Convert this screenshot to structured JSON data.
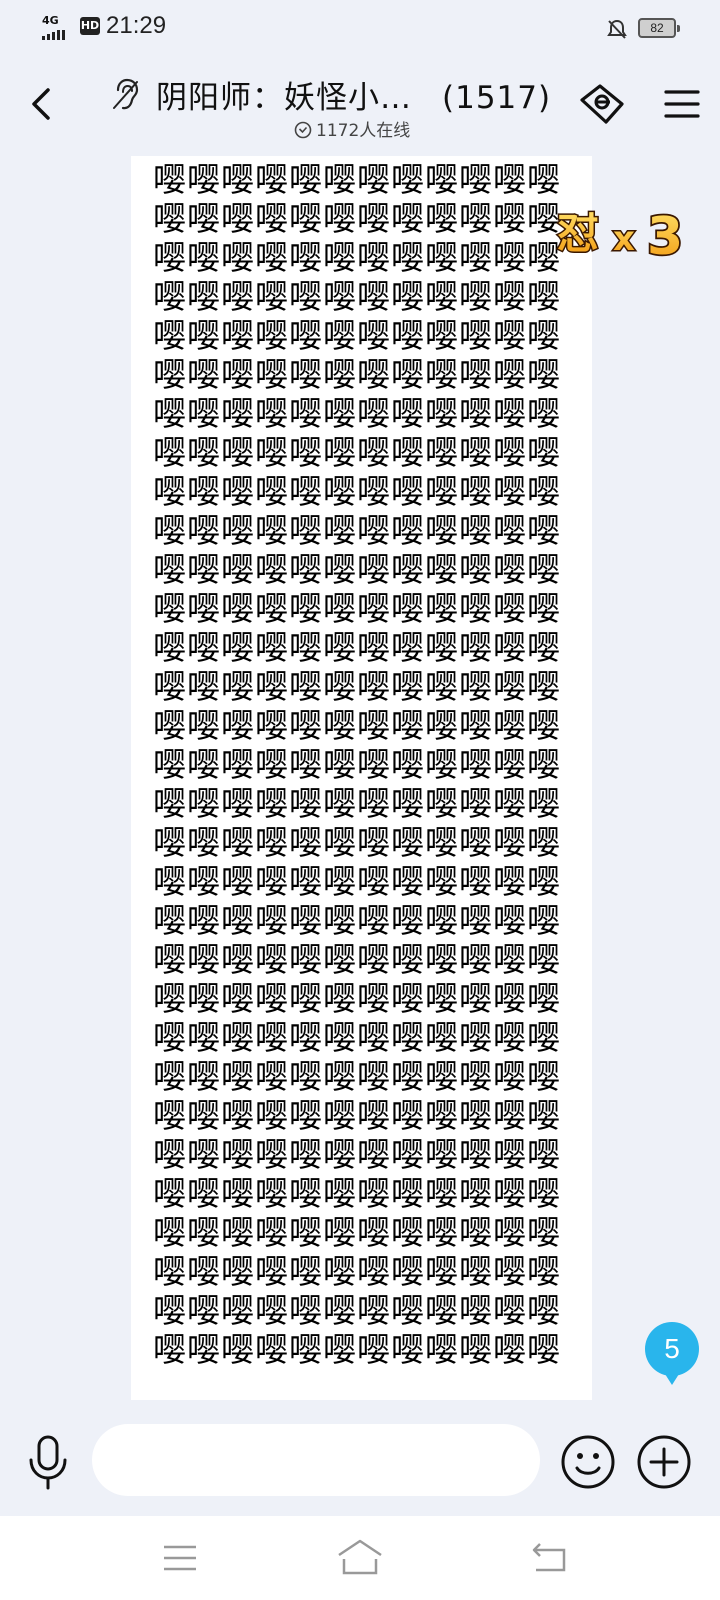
{
  "status_bar": {
    "network": "4G",
    "hd": "HD",
    "time": "21:29",
    "battery": "82"
  },
  "header": {
    "title": "阴阳师：妖怪小…",
    "member_count": "(1517)",
    "online": "1172人在线"
  },
  "message": {
    "repeated_char": "嘤",
    "rows_visible": 31,
    "chars_per_row": 12
  },
  "badge": {
    "text": "怼",
    "multiplier": "x",
    "count": "3"
  },
  "unread_count": "5",
  "input": {
    "placeholder": ""
  },
  "icons": {
    "back": "back-arrow-icon",
    "ear": "ear-icon",
    "tag": "tag-icon",
    "menu": "menu-icon",
    "mic": "microphone-icon",
    "emoji": "emoji-icon",
    "plus": "plus-icon"
  },
  "colors": {
    "background": "#eef1f8",
    "accent_blue": "#29b5ec",
    "badge_orange": "#f2a01a"
  }
}
